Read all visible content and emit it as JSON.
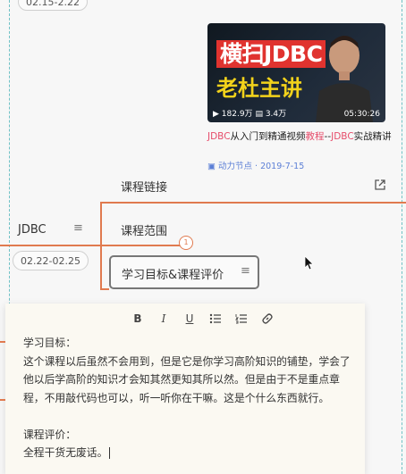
{
  "timeline": {
    "top_date": "02.15-2.22",
    "node_label": "JDBC",
    "node_date": "02.22-02.25",
    "badge_count": "1"
  },
  "video": {
    "thumb_line1": "横扫JDBC",
    "thumb_line2": "老杜主讲",
    "views": "182.9万",
    "likes": "3.4万",
    "duration": "05:30:26",
    "title_hl1": "JDBC",
    "title_mid": "从入门到精通视频",
    "title_hl2": "教程",
    "title_sep": "--",
    "title_hl3": "JDBC",
    "title_tail": "实战精讲",
    "channel": "动力节点",
    "sep": " · ",
    "date": "2019-7-15"
  },
  "topics": {
    "link_label": "课程链接",
    "scope_label": "课程范围",
    "goal_label": "学习目标&课程评价"
  },
  "editor": {
    "toolbar": [
      "B",
      "I",
      "U",
      "list",
      "numbered-list",
      "link"
    ],
    "goal_heading": "学习目标：",
    "goal_body": "这个课程以后虽然不会用到，但是它是你学习高阶知识的铺垫，学会了他以后学高阶的知识才会知其然更知其所以然。但是由于不是重点章程，不用敲代码也可以，听一听你在干嘛。这是个什么东西就行。",
    "review_heading": "课程评价：",
    "review_body": "全程干货无废话。"
  },
  "colors": {
    "accent": "#e07a4f",
    "dashed_line": "#6fc1c5",
    "highlight": "#e64c6a",
    "link": "#5c7fd6"
  }
}
